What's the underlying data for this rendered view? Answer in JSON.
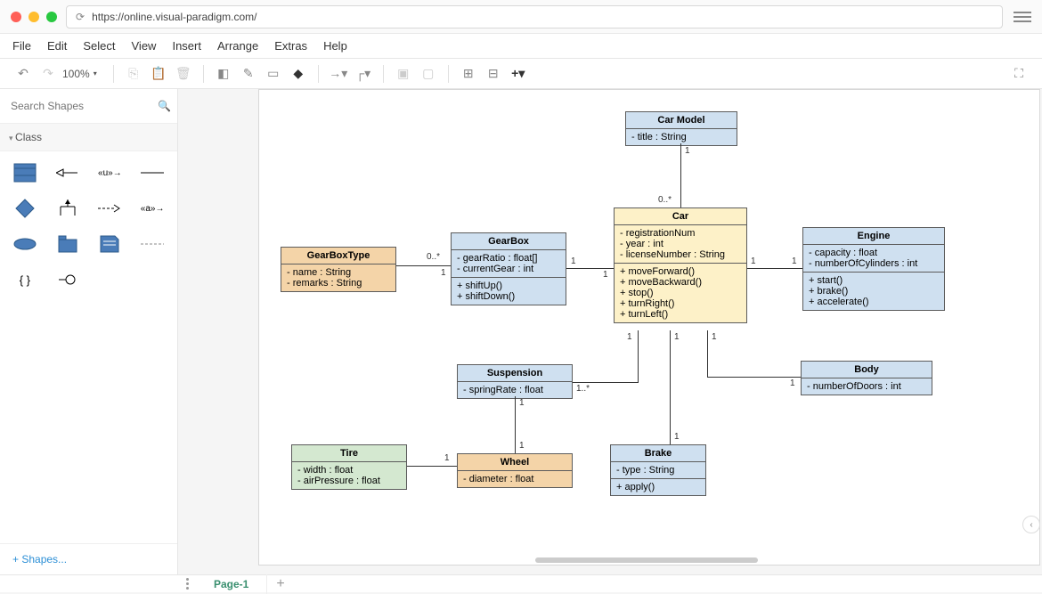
{
  "url": "https://online.visual-paradigm.com/",
  "menu": {
    "file": "File",
    "edit": "Edit",
    "select": "Select",
    "view": "View",
    "insert": "Insert",
    "arrange": "Arrange",
    "extras": "Extras",
    "help": "Help"
  },
  "zoom": "100%",
  "search_placeholder": "Search Shapes",
  "category": "Class",
  "shapes_link": "+  Shapes...",
  "page_tab": "Page-1",
  "classes": {
    "carmodel": {
      "name": "Car Model",
      "attrs": [
        "- title : String"
      ]
    },
    "car": {
      "name": "Car",
      "attrs": [
        "- registrationNum",
        "- year : int",
        "- licenseNumber : String"
      ],
      "ops": [
        "+ moveForward()",
        "+ moveBackward()",
        "+ stop()",
        "+ turnRight()",
        "+ turnLeft()"
      ]
    },
    "engine": {
      "name": "Engine",
      "attrs": [
        "- capacity : float",
        "- numberOfCylinders : int"
      ],
      "ops": [
        "+ start()",
        "+ brake()",
        "+ accelerate()"
      ]
    },
    "gearbox": {
      "name": "GearBox",
      "attrs": [
        "- gearRatio : float[]",
        "- currentGear : int"
      ],
      "ops": [
        "+ shiftUp()",
        "+ shiftDown()"
      ]
    },
    "gearboxtype": {
      "name": "GearBoxType",
      "attrs": [
        "- name : String",
        "- remarks : String"
      ]
    },
    "suspension": {
      "name": "Suspension",
      "attrs": [
        "- springRate : float"
      ]
    },
    "body": {
      "name": "Body",
      "attrs": [
        "- numberOfDoors : int"
      ]
    },
    "brake": {
      "name": "Brake",
      "attrs": [
        "- type : String"
      ],
      "ops": [
        "+ apply()"
      ]
    },
    "wheel": {
      "name": "Wheel",
      "attrs": [
        "- diameter : float"
      ]
    },
    "tire": {
      "name": "Tire",
      "attrs": [
        "- width : float",
        "- airPressure : float"
      ]
    }
  },
  "mults": {
    "m1": "1",
    "m2": "0..*",
    "m3": "1",
    "m4": "1",
    "m5": "0..*",
    "m6": "1",
    "m7": "1",
    "m8": "1",
    "m9": "1",
    "m10": "1",
    "m11": "1..*",
    "m12": "1",
    "m13": "1",
    "m14": "1",
    "m15": "1",
    "m16": "1",
    "m17": "1"
  }
}
